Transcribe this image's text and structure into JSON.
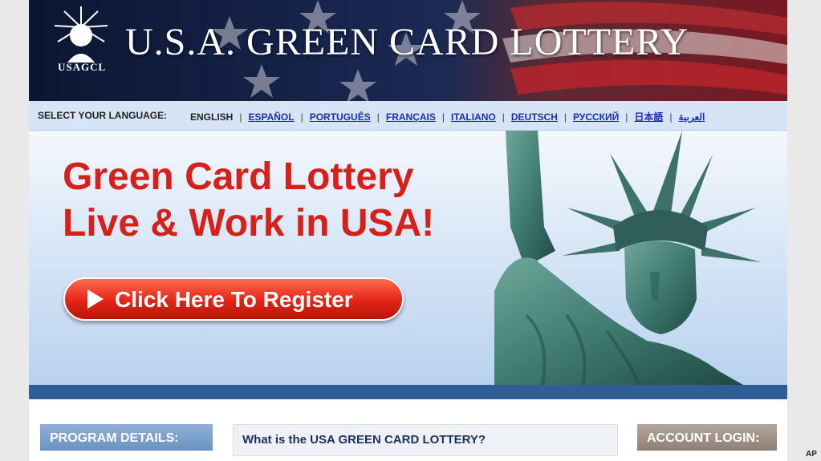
{
  "header": {
    "logo_text": "USAGCL",
    "title": "U.S.A. GREEN CARD LOTTERY"
  },
  "language_bar": {
    "label": "SELECT YOUR LANGUAGE:",
    "languages": [
      {
        "label": "ENGLISH",
        "current": true
      },
      {
        "label": "ESPAÑOL"
      },
      {
        "label": "PORTUGUÊS"
      },
      {
        "label": "FRANÇAIS"
      },
      {
        "label": "ITALIANO"
      },
      {
        "label": "DEUTSCH"
      },
      {
        "label": "РУССКИЙ"
      },
      {
        "label": "日本語"
      },
      {
        "label": "العربية"
      }
    ]
  },
  "hero": {
    "headline_line1": "Green Card Lottery",
    "headline_line2": "Live & Work in USA!",
    "register_button": "Click Here To Register"
  },
  "panels": {
    "program_details": "PROGRAM DETAILS:",
    "main_heading": "What is the USA GREEN CARD LOTTERY?",
    "account_login": "ACCOUNT LOGIN:"
  },
  "credit": "AP",
  "colors": {
    "headline_red": "#d8201a",
    "link_blue": "#1c2eb5",
    "stripe_blue": "#2f5e96"
  }
}
